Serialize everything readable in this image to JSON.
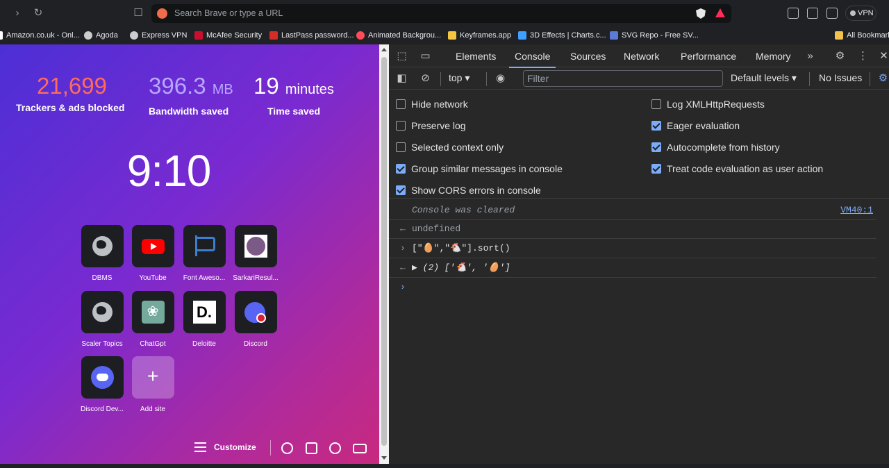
{
  "browser": {
    "url_placeholder": "Search Brave or type a URL",
    "vpn_label": "VPN",
    "bookmarks": [
      {
        "label": "Amazon.co.uk - Onl...",
        "color": "#ffffff"
      },
      {
        "label": "Agoda",
        "color": "#cccccc"
      },
      {
        "label": "Express VPN",
        "color": "#cccccc"
      },
      {
        "label": "McAfee Security",
        "color": "#c8102e"
      },
      {
        "label": "LastPass password...",
        "color": "#d32d27"
      },
      {
        "label": "Animated Backgrou...",
        "color": "#ff4d5a"
      },
      {
        "label": "Keyframes.app",
        "color": "#f5c542"
      },
      {
        "label": "3D Effects | Charts.c...",
        "color": "#3fa0ff"
      },
      {
        "label": "SVG Repo - Free SV...",
        "color": "#5a7bd6"
      }
    ],
    "all_bookmarks": "All Bookmarks"
  },
  "newtab": {
    "stats": [
      {
        "value": "21,699",
        "unit": "",
        "label": "Trackers & ads blocked",
        "color": "#ff6b5b"
      },
      {
        "value": "396.3",
        "unit": "MB",
        "label": "Bandwidth saved",
        "color": "#b9a7ff"
      },
      {
        "value": "19",
        "unit": "minutes",
        "label": "Time saved",
        "color": "#ffffff"
      }
    ],
    "clock": "9:10",
    "tiles": [
      {
        "label": "DBMS",
        "icon": "globe-icon"
      },
      {
        "label": "YouTube",
        "icon": "youtube-icon"
      },
      {
        "label": "Font Aweso...",
        "icon": "font-awesome-icon"
      },
      {
        "label": "SarkariResul...",
        "icon": "sarkari-result-icon"
      },
      {
        "label": "Scaler Topics",
        "icon": "globe-icon"
      },
      {
        "label": "ChatGpt",
        "icon": "chatgpt-icon"
      },
      {
        "label": "Deloitte",
        "icon": "deloitte-icon"
      },
      {
        "label": "Discord",
        "icon": "discord-icon"
      },
      {
        "label": "Discord Dev...",
        "icon": "discord-developer-icon"
      },
      {
        "label": "Add site",
        "icon": "plus-icon"
      }
    ],
    "deloitte_letter": "D.",
    "customize_label": "Customize"
  },
  "devtools": {
    "tabs": [
      "Elements",
      "Console",
      "Sources",
      "Network",
      "Performance",
      "Memory"
    ],
    "active_tab": "Console",
    "context": "top",
    "filter_placeholder": "Filter",
    "levels": "Default levels",
    "issues": "No Issues",
    "settings_left": [
      {
        "label": "Hide network",
        "checked": false
      },
      {
        "label": "Preserve log",
        "checked": false
      },
      {
        "label": "Selected context only",
        "checked": false
      },
      {
        "label": "Group similar messages in console",
        "checked": true
      },
      {
        "label": "Show CORS errors in console",
        "checked": true
      }
    ],
    "settings_right": [
      {
        "label": "Log XMLHttpRequests",
        "checked": false
      },
      {
        "label": "Eager evaluation",
        "checked": true
      },
      {
        "label": "Autocomplete from history",
        "checked": true
      },
      {
        "label": "Treat code evaluation as user action",
        "checked": true
      }
    ],
    "console": {
      "cleared": "Console was cleared",
      "cleared_source": "VM40:1",
      "undefined": "undefined",
      "input": "[\"🥚\",\"🐔\"].sort()",
      "output": "(2) ['🐔', '🥚']"
    }
  }
}
